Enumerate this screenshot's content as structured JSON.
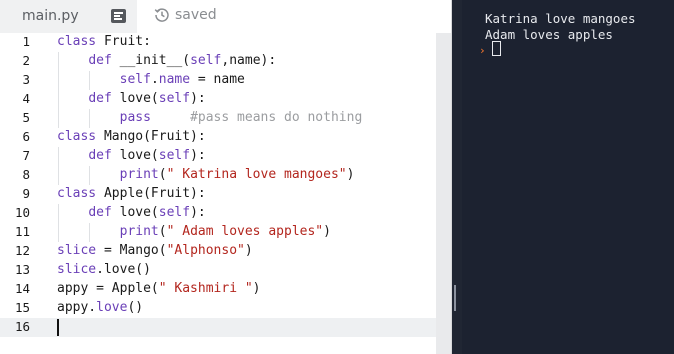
{
  "editor": {
    "file_tab": "main.py",
    "menu_icon": "file-menu-icon",
    "status_icon": "history-icon",
    "status_label": "saved",
    "lines": [
      {
        "no": "1",
        "tokens": [
          {
            "t": "kw",
            "v": "class"
          },
          {
            "t": "p",
            "v": " Fruit:"
          }
        ]
      },
      {
        "no": "2",
        "tokens": [
          {
            "t": "p",
            "v": "    "
          },
          {
            "t": "kw",
            "v": "def"
          },
          {
            "t": "p",
            "v": " __init__("
          },
          {
            "t": "kw",
            "v": "self"
          },
          {
            "t": "p",
            "v": ",name):"
          }
        ]
      },
      {
        "no": "3",
        "tokens": [
          {
            "t": "p",
            "v": "        "
          },
          {
            "t": "kw",
            "v": "self"
          },
          {
            "t": "p",
            "v": "."
          },
          {
            "t": "kw",
            "v": "name"
          },
          {
            "t": "p",
            "v": " = name"
          }
        ]
      },
      {
        "no": "4",
        "tokens": [
          {
            "t": "p",
            "v": "    "
          },
          {
            "t": "kw",
            "v": "def"
          },
          {
            "t": "p",
            "v": " love("
          },
          {
            "t": "kw",
            "v": "self"
          },
          {
            "t": "p",
            "v": "):"
          }
        ]
      },
      {
        "no": "5",
        "tokens": [
          {
            "t": "p",
            "v": "        "
          },
          {
            "t": "kw",
            "v": "pass"
          },
          {
            "t": "p",
            "v": "     "
          },
          {
            "t": "cmt",
            "v": "#pass means do nothing"
          }
        ]
      },
      {
        "no": "6",
        "tokens": [
          {
            "t": "kw",
            "v": "class"
          },
          {
            "t": "p",
            "v": " Mango(Fruit):"
          }
        ]
      },
      {
        "no": "7",
        "tokens": [
          {
            "t": "p",
            "v": "    "
          },
          {
            "t": "kw",
            "v": "def"
          },
          {
            "t": "p",
            "v": " love("
          },
          {
            "t": "kw",
            "v": "self"
          },
          {
            "t": "p",
            "v": "):"
          }
        ]
      },
      {
        "no": "8",
        "tokens": [
          {
            "t": "p",
            "v": "        "
          },
          {
            "t": "kw",
            "v": "print"
          },
          {
            "t": "p",
            "v": "("
          },
          {
            "t": "str",
            "v": "\" Katrina love mangoes\""
          },
          {
            "t": "p",
            "v": ")"
          }
        ]
      },
      {
        "no": "9",
        "tokens": [
          {
            "t": "kw",
            "v": "class"
          },
          {
            "t": "p",
            "v": " Apple(Fruit):"
          }
        ]
      },
      {
        "no": "10",
        "tokens": [
          {
            "t": "p",
            "v": "    "
          },
          {
            "t": "kw",
            "v": "def"
          },
          {
            "t": "p",
            "v": " love("
          },
          {
            "t": "kw",
            "v": "self"
          },
          {
            "t": "p",
            "v": "):"
          }
        ]
      },
      {
        "no": "11",
        "tokens": [
          {
            "t": "p",
            "v": "        "
          },
          {
            "t": "kw",
            "v": "print"
          },
          {
            "t": "p",
            "v": "("
          },
          {
            "t": "str",
            "v": "\" Adam loves apples\""
          },
          {
            "t": "p",
            "v": ")"
          }
        ]
      },
      {
        "no": "12",
        "tokens": [
          {
            "t": "kw",
            "v": "slice"
          },
          {
            "t": "p",
            "v": " = Mango("
          },
          {
            "t": "str",
            "v": "\"Alphonso\""
          },
          {
            "t": "p",
            "v": ")"
          }
        ]
      },
      {
        "no": "13",
        "tokens": [
          {
            "t": "kw",
            "v": "slice"
          },
          {
            "t": "p",
            "v": ".love()"
          }
        ]
      },
      {
        "no": "14",
        "tokens": [
          {
            "t": "p",
            "v": "appy = Apple("
          },
          {
            "t": "str",
            "v": "\" Kashmiri \""
          },
          {
            "t": "p",
            "v": ")"
          }
        ]
      },
      {
        "no": "15",
        "tokens": [
          {
            "t": "p",
            "v": "appy."
          },
          {
            "t": "kw",
            "v": "love"
          },
          {
            "t": "p",
            "v": "()"
          }
        ]
      },
      {
        "no": "16",
        "tokens": []
      }
    ],
    "active_line": 16
  },
  "console": {
    "output": [
      "Katrina love mangoes",
      "Adam loves apples"
    ],
    "prompt_glyph": "›",
    "prompt_icon": "prompt-chevron-icon"
  },
  "colors": {
    "keyword": "#6a3fb7",
    "string": "#b3261e",
    "comment": "#9b9da0",
    "console_bg": "#1c2230",
    "prompt": "#ff7a2e"
  }
}
